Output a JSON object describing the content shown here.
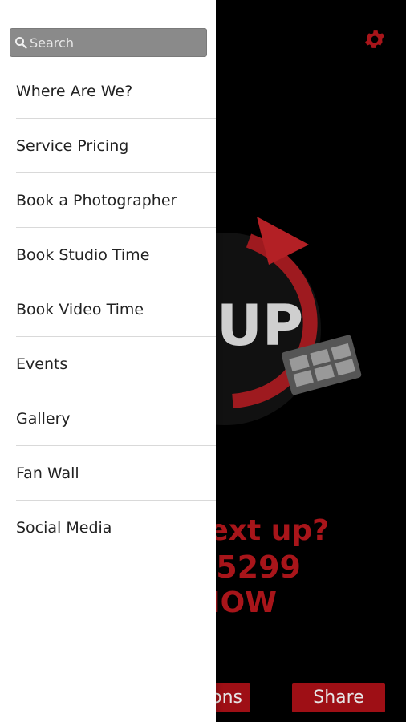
{
  "drawer": {
    "search_placeholder": "Search",
    "items": [
      {
        "label": "Where Are We?"
      },
      {
        "label": "Service Pricing"
      },
      {
        "label": "Book a Photographer"
      },
      {
        "label": "Book Studio Time"
      },
      {
        "label": "Book Video Time"
      },
      {
        "label": "Events"
      },
      {
        "label": "Gallery"
      },
      {
        "label": "Fan Wall"
      },
      {
        "label": "Social Media"
      }
    ]
  },
  "background": {
    "promo": {
      "line1": "ext up?",
      "line2": "-5299",
      "line3": "NOW"
    },
    "buttons": {
      "options_label": "ons",
      "share_label": "Share"
    },
    "logo_text": "UP"
  },
  "colors": {
    "accent": "#a8151a",
    "button_bg": "#9e0f15",
    "drawer_bg": "#ffffff",
    "search_bg": "#8a8a8a"
  }
}
